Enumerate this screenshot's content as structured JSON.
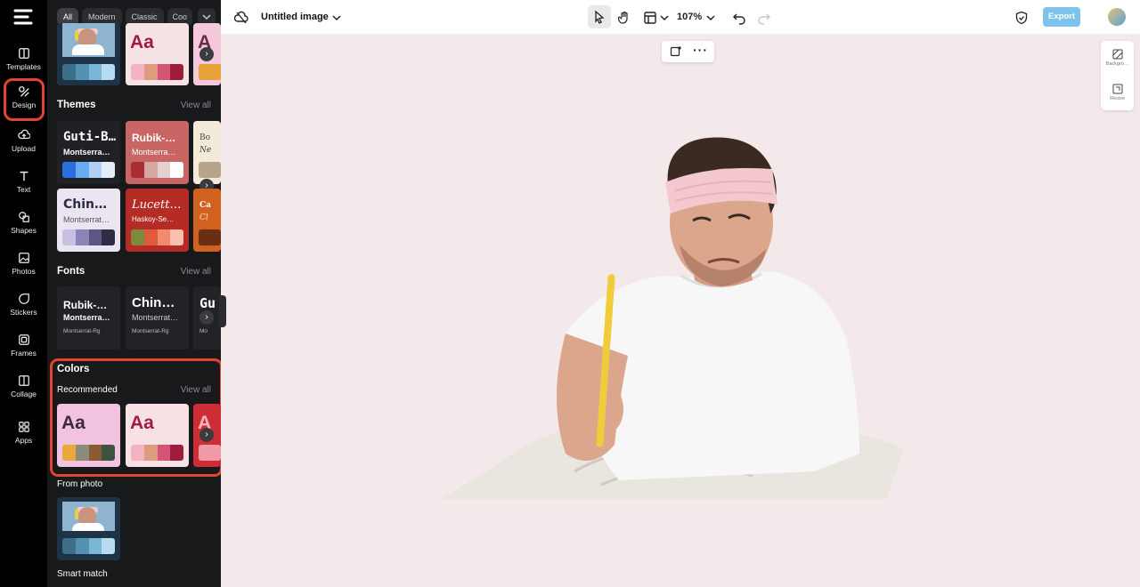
{
  "rail": {
    "items": [
      {
        "label": "Templates",
        "icon": "templates-icon"
      },
      {
        "label": "Design",
        "icon": "design-icon"
      },
      {
        "label": "Upload",
        "icon": "upload-icon"
      },
      {
        "label": "Text",
        "icon": "text-icon"
      },
      {
        "label": "Shapes",
        "icon": "shapes-icon"
      },
      {
        "label": "Photos",
        "icon": "photos-icon"
      },
      {
        "label": "Stickers",
        "icon": "stickers-icon"
      },
      {
        "label": "Frames",
        "icon": "frames-icon"
      },
      {
        "label": "Collage",
        "icon": "collage-icon"
      },
      {
        "label": "Apps",
        "icon": "apps-icon"
      }
    ]
  },
  "panel": {
    "filters": [
      "All",
      "Modern",
      "Classic",
      "Coo"
    ],
    "top_row": {
      "aa_label": "Aa",
      "peek_label": "A"
    },
    "themes": {
      "title": "Themes",
      "view_all": "View all",
      "cards": [
        {
          "t1": "Guti-B…",
          "t2": "Montserra…"
        },
        {
          "t1": "Rubik-…",
          "t2": "Montserra…"
        },
        {
          "t1": "Bo",
          "t2": "Ne"
        },
        {
          "t1": "Chin…",
          "t2": "Montserrat…"
        },
        {
          "t1": "Lucett…",
          "t2": "Haskoy-Se…"
        },
        {
          "t1": "Ca",
          "t2": "Cl"
        }
      ]
    },
    "fonts": {
      "title": "Fonts",
      "view_all": "View all",
      "cards": [
        {
          "t1": "Rubik-…",
          "t2": "Montserra…",
          "t3": "Montserrat-Rg"
        },
        {
          "t1": "Chin…",
          "t2": "Montserrat…",
          "t3": "Montserrat-Rg"
        },
        {
          "t1": "Gu",
          "t2": "Mo",
          "t3": "Mo"
        }
      ]
    },
    "colors": {
      "title": "Colors",
      "recommended": "Recommended",
      "view_all": "View all",
      "aa": "Aa",
      "peek": "A",
      "from_photo": "From photo",
      "smart_match": "Smart match"
    }
  },
  "topbar": {
    "title": "Untitled image",
    "zoom": "107%",
    "export": "Export"
  },
  "right_tools": {
    "background": "Backgro…",
    "resize": "Resize"
  },
  "colors": {
    "accent": "#e2442f",
    "export_bg": "#7ec3ec",
    "canvas_bg": "#f4e9ea"
  }
}
